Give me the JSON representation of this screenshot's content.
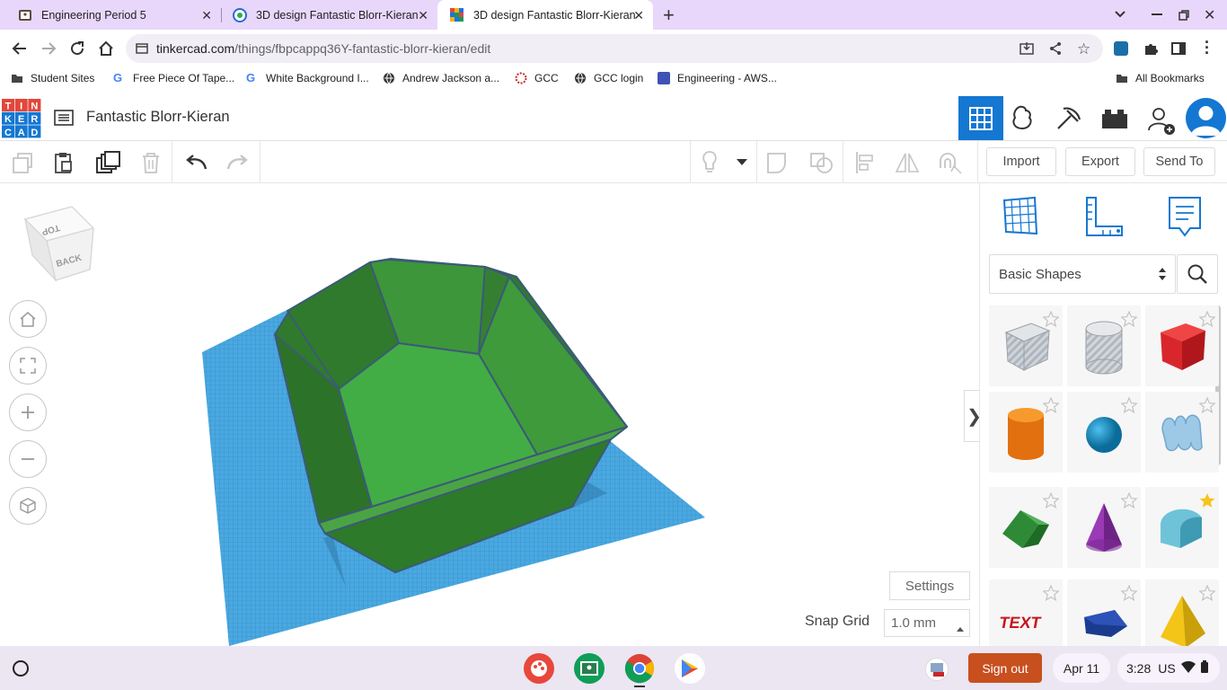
{
  "browser": {
    "tabs": [
      {
        "title": "Engineering Period 5",
        "active": false
      },
      {
        "title": "3D design Fantastic Blorr-Kieran",
        "active": false
      },
      {
        "title": "3D design Fantastic Blorr-Kieran",
        "active": true
      }
    ],
    "url_domain": "tinkercad.com",
    "url_path": "/things/fbpcappq36Y-fantastic-blorr-kieran/edit",
    "bookmarks": [
      {
        "label": "Student Sites"
      },
      {
        "label": "Free Piece Of Tape..."
      },
      {
        "label": "White Background I..."
      },
      {
        "label": "Andrew Jackson a..."
      },
      {
        "label": "GCC"
      },
      {
        "label": "GCC login"
      },
      {
        "label": "Engineering - AWS..."
      }
    ],
    "all_bookmarks": "All Bookmarks"
  },
  "app": {
    "logo_letters": [
      "T",
      "I",
      "N",
      "K",
      "E",
      "R",
      "C",
      "A",
      "D"
    ],
    "design_title": "Fantastic Blorr-Kieran"
  },
  "toolbar": {
    "import_label": "Import",
    "export_label": "Export",
    "send_to_label": "Send To"
  },
  "viewcube": {
    "top": "TOP",
    "back": "BACK"
  },
  "viewport": {
    "settings_label": "Settings",
    "snap_grid_label": "Snap Grid",
    "snap_grid_value": "1.0 mm"
  },
  "panel": {
    "library_select": "Basic Shapes",
    "shapes": [
      {
        "name": "Box Hole",
        "favorite": false
      },
      {
        "name": "Cylinder Hole",
        "favorite": false
      },
      {
        "name": "Box",
        "favorite": false
      },
      {
        "name": "Cylinder",
        "favorite": false
      },
      {
        "name": "Sphere",
        "favorite": false
      },
      {
        "name": "Scribble",
        "favorite": false
      },
      {
        "name": "Roof",
        "favorite": false
      },
      {
        "name": "Cone",
        "favorite": false
      },
      {
        "name": "Round Roof",
        "favorite": true
      },
      {
        "name": "Text",
        "favorite": false
      },
      {
        "name": "Half Sphere",
        "favorite": false
      },
      {
        "name": "Pyramid",
        "favorite": false
      }
    ],
    "text_shape_label": "TEXT"
  },
  "shelf": {
    "sign_out": "Sign out",
    "date": "Apr 11",
    "time": "3:28",
    "locale": "US"
  },
  "colors": {
    "tabbar": "#e9d7fb",
    "tinkercad_blue": "#1477d1",
    "grid_blue": "#4aa8e0",
    "shape_green": "#3c9a3a",
    "sign_out_orange": "#c84f1e"
  }
}
